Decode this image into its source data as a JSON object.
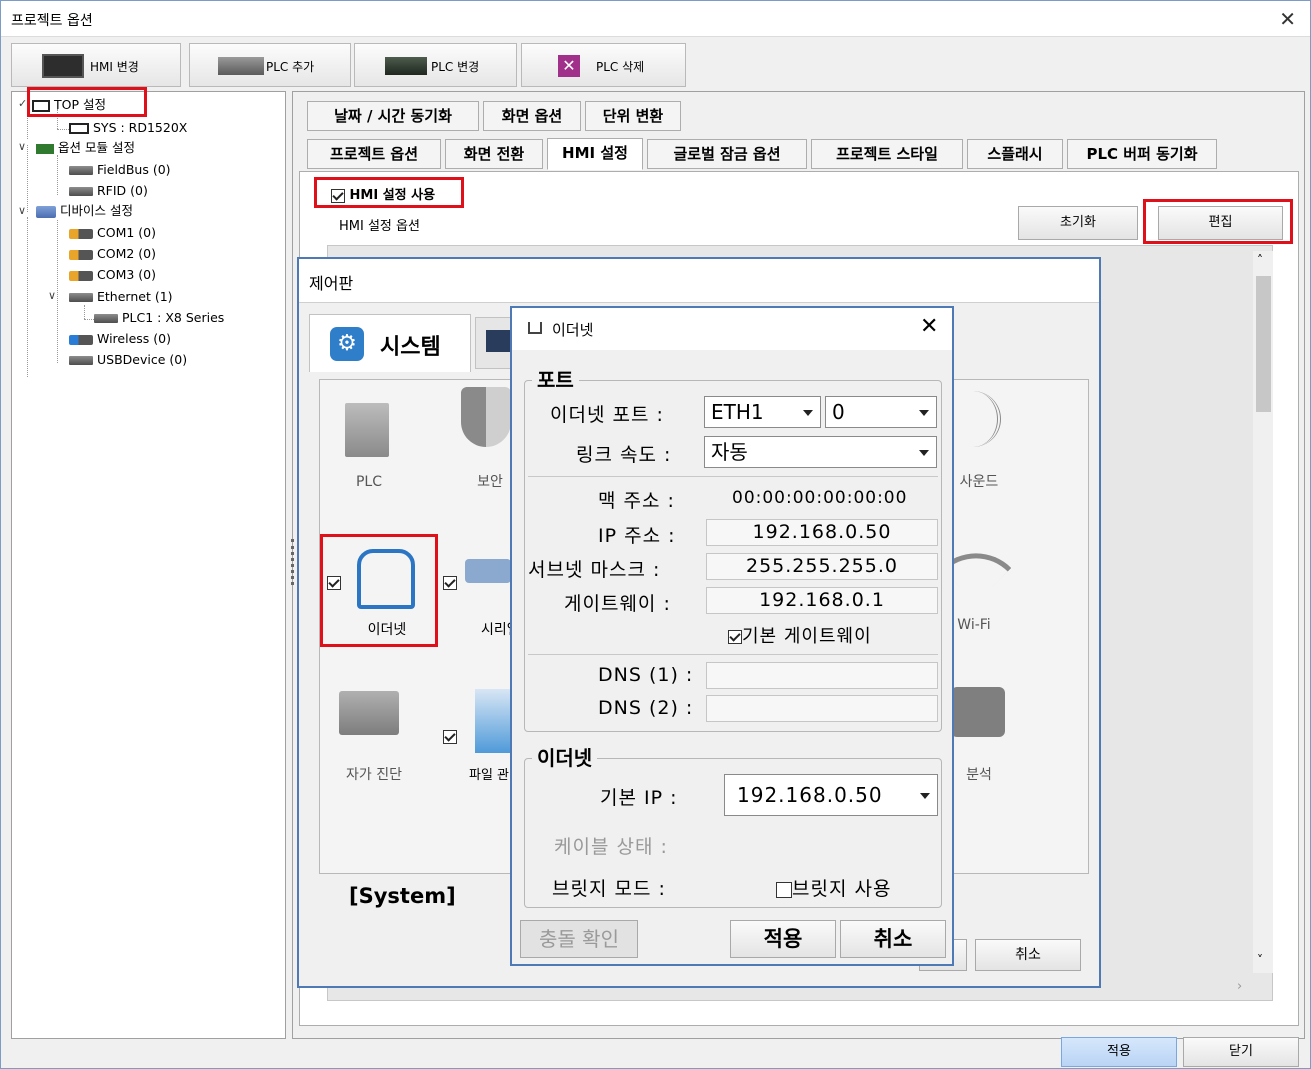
{
  "window": {
    "title": "프로젝트 옵션",
    "close": "✕"
  },
  "toolbar": {
    "hmi_change": "HMI 변경",
    "plc_add": "PLC 추가",
    "plc_change": "PLC 변경",
    "plc_delete": "PLC 삭제"
  },
  "tree": {
    "top": "TOP 설정",
    "sys": "SYS : RD1520X",
    "option_module": "옵션 모듈 설정",
    "fieldbus": "FieldBus (0)",
    "rfid": "RFID (0)",
    "device": "디바이스 설정",
    "com1": "COM1 (0)",
    "com2": "COM2 (0)",
    "com3": "COM3 (0)",
    "ethernet": "Ethernet (1)",
    "plc1": "PLC1 : X8 Series",
    "wireless": "Wireless (0)",
    "usb": "USBDevice (0)"
  },
  "tabs_row1": [
    "날짜 / 시간 동기화",
    "화면 옵션",
    "단위 변환"
  ],
  "tabs_row2": [
    "프로젝트 옵션",
    "화면 전환",
    "HMI 설정",
    "글로벌 잠금 옵션",
    "프로젝트 스타일",
    "스플래시",
    "PLC 버퍼 동기화"
  ],
  "hmi": {
    "use_label": "HMI 설정 사용",
    "options_label": "HMI 설정 옵션",
    "reset": "초기화",
    "edit": "편집"
  },
  "control_panel": {
    "title": "제어판",
    "tab_system": "시스템",
    "items": [
      "PLC",
      "보안",
      "사운드",
      "이더넷",
      "시리얼",
      "Wi-Fi",
      "자가 진단",
      "파일 관리자",
      "분석"
    ],
    "footer": "[System]",
    "cancel": "취소"
  },
  "ethernet_dialog": {
    "title": "이더넷",
    "port_group": "포트",
    "eth_port_label": "이더넷 포트 :",
    "eth_port_value": "ETH1",
    "eth_port_num": "0",
    "link_speed_label": "링크 속도 :",
    "link_speed_value": "자동",
    "mac_label": "맥 주소 :",
    "mac_value": "00:00:00:00:00:00",
    "ip_label": "IP 주소 :",
    "ip_value": "192.168.0.50",
    "subnet_label": "서브넷 마스크 :",
    "subnet_value": "255.255.255.0",
    "gateway_label": "게이트웨이 :",
    "gateway_value": "192.168.0.1",
    "default_gateway": "기본 게이트웨이",
    "dns1_label": "DNS (1) :",
    "dns1_value": "",
    "dns2_label": "DNS (2) :",
    "dns2_value": "",
    "eth_group": "이더넷",
    "default_ip_label": "기본 IP :",
    "default_ip_value": "192.168.0.50",
    "cable_label": "케이블 상태 :",
    "bridge_label": "브릿지 모드 :",
    "bridge_use": "브릿지 사용",
    "conflict": "충돌 확인",
    "apply": "적용",
    "cancel": "취소"
  },
  "footer": {
    "apply": "적용",
    "close": "닫기"
  }
}
